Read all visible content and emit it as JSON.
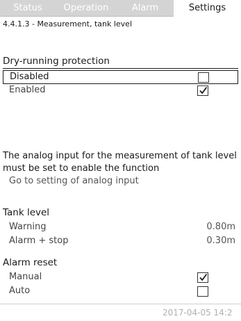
{
  "tabs": [
    {
      "label": "Status",
      "active": false
    },
    {
      "label": "Operation",
      "active": false
    },
    {
      "label": "Alarm",
      "active": false
    },
    {
      "label": "Settings",
      "active": true
    }
  ],
  "breadcrumb": "4.4.1.3 - Measurement, tank level",
  "dry_running": {
    "title": "Dry-running protection",
    "options": [
      {
        "label": "Disabled",
        "checked": false,
        "selected": true
      },
      {
        "label": "Enabled",
        "checked": true,
        "selected": false
      }
    ]
  },
  "info": {
    "text": "The analog input for the measurement of tank level must be set to enable the function",
    "link_label": "Go to setting of analog input"
  },
  "tank_level": {
    "title": "Tank level",
    "rows": [
      {
        "label": "Warning",
        "value": "0.80m"
      },
      {
        "label": "Alarm + stop",
        "value": "0.30m"
      }
    ]
  },
  "alarm_reset": {
    "title": "Alarm reset",
    "options": [
      {
        "label": "Manual",
        "checked": true
      },
      {
        "label": "Auto",
        "checked": false
      }
    ]
  },
  "footer": {
    "datetime": "2017-04-05 14:2"
  },
  "colors": {
    "tab_bar": "#d4d4d4",
    "text": "#1a1a1a",
    "muted": "#555555",
    "datetime": "#b0b0b0"
  }
}
